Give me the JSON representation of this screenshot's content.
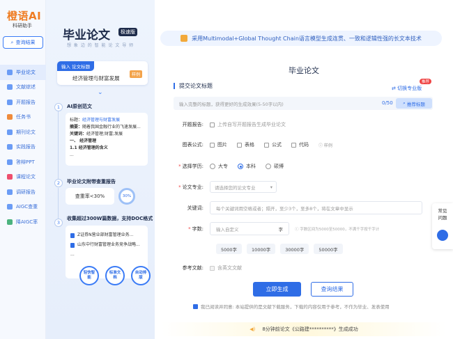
{
  "sidebar": {
    "logo_title": "橙语AI",
    "logo_sub": "科研助手",
    "query_button": "查询结果",
    "items": [
      {
        "label": "毕业论文",
        "icon": "graduation-cap-icon",
        "active": true
      },
      {
        "label": "文献综述",
        "icon": "document-icon"
      },
      {
        "label": "开题报告",
        "icon": "report-icon"
      },
      {
        "label": "任务书",
        "icon": "task-icon"
      },
      {
        "label": "期刊论文",
        "icon": "journal-icon"
      },
      {
        "label": "实践报告",
        "icon": "practice-icon"
      },
      {
        "label": "答辩PPT",
        "icon": "ppt-icon"
      },
      {
        "label": "课程论文",
        "icon": "course-icon"
      },
      {
        "label": "调研报告",
        "icon": "survey-icon"
      },
      {
        "label": "AIGC查重",
        "icon": "aigc-check-icon"
      },
      {
        "label": "降AIGC率",
        "icon": "aigc-reduce-icon"
      }
    ]
  },
  "promo": {
    "title": "毕业论文",
    "badge": "极速版",
    "subtitle": "想 象 边 的 智 能 论 文 导 师",
    "input_tab": "输入 论文标题",
    "input_value": "经济管理与财富发展",
    "example_tag": "样例",
    "step1": "AI原创范文",
    "outline": {
      "title_label": "标题：",
      "title_value": "经济管理与财富发展",
      "abstract_label": "摘要：",
      "abstract_value": "随着我国金融行业的飞速发展...",
      "keywords_label": "关键词：",
      "keywords_value": "经济管理;财富;发展",
      "h1": "一、 经济管理",
      "h2": "1.1 经济管理的含义",
      "more": "..."
    },
    "step2": "毕业论文附带查重报告",
    "dup_rate": "查重率<30%",
    "dup_ring": "30%",
    "step3": "收集超过300W篇数据，支持DOC格式",
    "docs": [
      "Z证券N营业部财富管理业务...",
      "山东中行财富管理业务竞争战略..."
    ],
    "docs_more": "...",
    "features": [
      "轻快智能",
      "标准文档",
      "自动排版"
    ]
  },
  "main": {
    "banner": "采用Multimodal+Global Thought Chain语言模型生成连贯、一致和逻辑性强的长文本技术",
    "page_title": "毕业论文",
    "section_title": "提交论文标题",
    "switch_link": "切换专业版",
    "hot_badge": "推荐",
    "title_placeholder": "输入完整的标题，获得更好的生成效果(5-50字以内)",
    "counter": "0/50",
    "recommend_button": "推荐标题",
    "proposal_label": "开题报告:",
    "proposal_option": "上传自写开题报告生成毕业论文",
    "charts_label": "图表公式:",
    "charts_options": [
      "图片",
      "表格",
      "公式",
      "代码"
    ],
    "charts_sample": "样例",
    "degree_label": "选择学历:",
    "degree_options": [
      "大专",
      "本科",
      "硕博"
    ],
    "degree_selected": "本科",
    "major_label": "论文专业:",
    "major_placeholder": "请选择您的论文专业",
    "keywords_label": "关键词:",
    "keywords_placeholder": "每个关键词用空格或者；隔开，至少3个，至多8个，将在文章中显示",
    "wordcount_label": "字数:",
    "wordcount_placeholder": "输入自定义",
    "wordcount_unit": "字",
    "wordcount_hint": "字数区间为5000至50000，不满千字按千字计",
    "wordcount_chips": [
      "5000字",
      "10000字",
      "30000字",
      "50000字"
    ],
    "refs_label": "参考文献:",
    "refs_option": "含英文文献",
    "generate_button": "立即生成",
    "query_button": "查询结果",
    "agreement": "我已阅读并同意: 本站提供的是文献下载服务，下载的内容仅用于参考，不作为毕业、发表使用",
    "notice": "8分钟前论文《公路建**********》生成成功"
  },
  "float": {
    "help": "常见问题"
  }
}
